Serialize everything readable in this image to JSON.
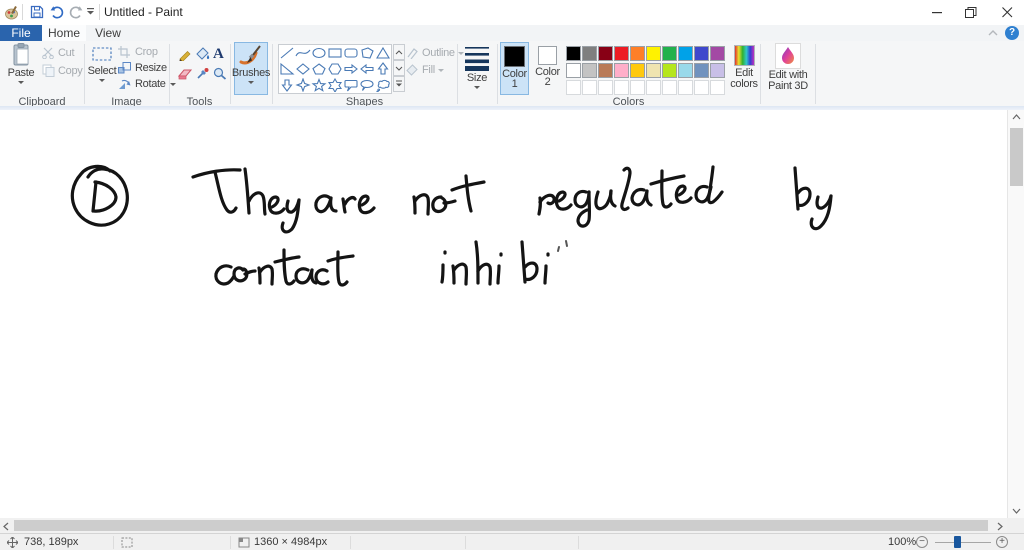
{
  "titlebar": {
    "title": "Untitled - Paint"
  },
  "tabs": {
    "file": "File",
    "home": "Home",
    "view": "View"
  },
  "ribbon": {
    "clipboard": {
      "label": "Clipboard",
      "paste": "Paste",
      "cut": "Cut",
      "copy": "Copy"
    },
    "image": {
      "label": "Image",
      "select": "Select",
      "crop": "Crop",
      "resize": "Resize",
      "rotate": "Rotate"
    },
    "tools": {
      "label": "Tools"
    },
    "brushes": {
      "label": "Brushes"
    },
    "shapes": {
      "label": "Shapes",
      "outline": "Outline",
      "fill": "Fill",
      "items": [
        "line",
        "curve",
        "ellipse",
        "rectangle",
        "rounded-rectangle",
        "polygon",
        "triangle",
        "right-triangle",
        "diamond",
        "pentagon",
        "hexagon",
        "arrow-right",
        "arrow-left",
        "arrow-up",
        "arrow-down",
        "star-4",
        "star-5",
        "star-6",
        "callout-rounded",
        "callout-oval",
        "callout-cloud"
      ]
    },
    "size": {
      "label": "Size"
    },
    "colors": {
      "label": "Colors",
      "color1_line1": "Color",
      "color1_line2": "1",
      "color2_line1": "Color",
      "color2_line2": "2",
      "edit_line1": "Edit",
      "edit_line2": "colors",
      "color1_value": "#000000",
      "color2_value": "#ffffff",
      "row1": [
        "#000000",
        "#7f7f7f",
        "#880015",
        "#ed1c24",
        "#ff7f27",
        "#fff200",
        "#22b14c",
        "#00a2e8",
        "#3f48cc",
        "#a349a4"
      ],
      "row2": [
        "#ffffff",
        "#c3c3c3",
        "#b97a57",
        "#ffaec9",
        "#ffc90e",
        "#efe4b0",
        "#b5e61d",
        "#99d9ea",
        "#7092be",
        "#c8bfe7"
      ],
      "empty_count": 10
    },
    "paint3d": {
      "line1": "Edit with",
      "line2": "Paint 3D"
    }
  },
  "canvas": {
    "handwriting_line1": "D) They are not regulated by",
    "handwriting_line2": "contact inhibi"
  },
  "statusbar": {
    "cursor": "738, 189px",
    "image_size": "1360 × 4984px",
    "zoom": "100%"
  }
}
